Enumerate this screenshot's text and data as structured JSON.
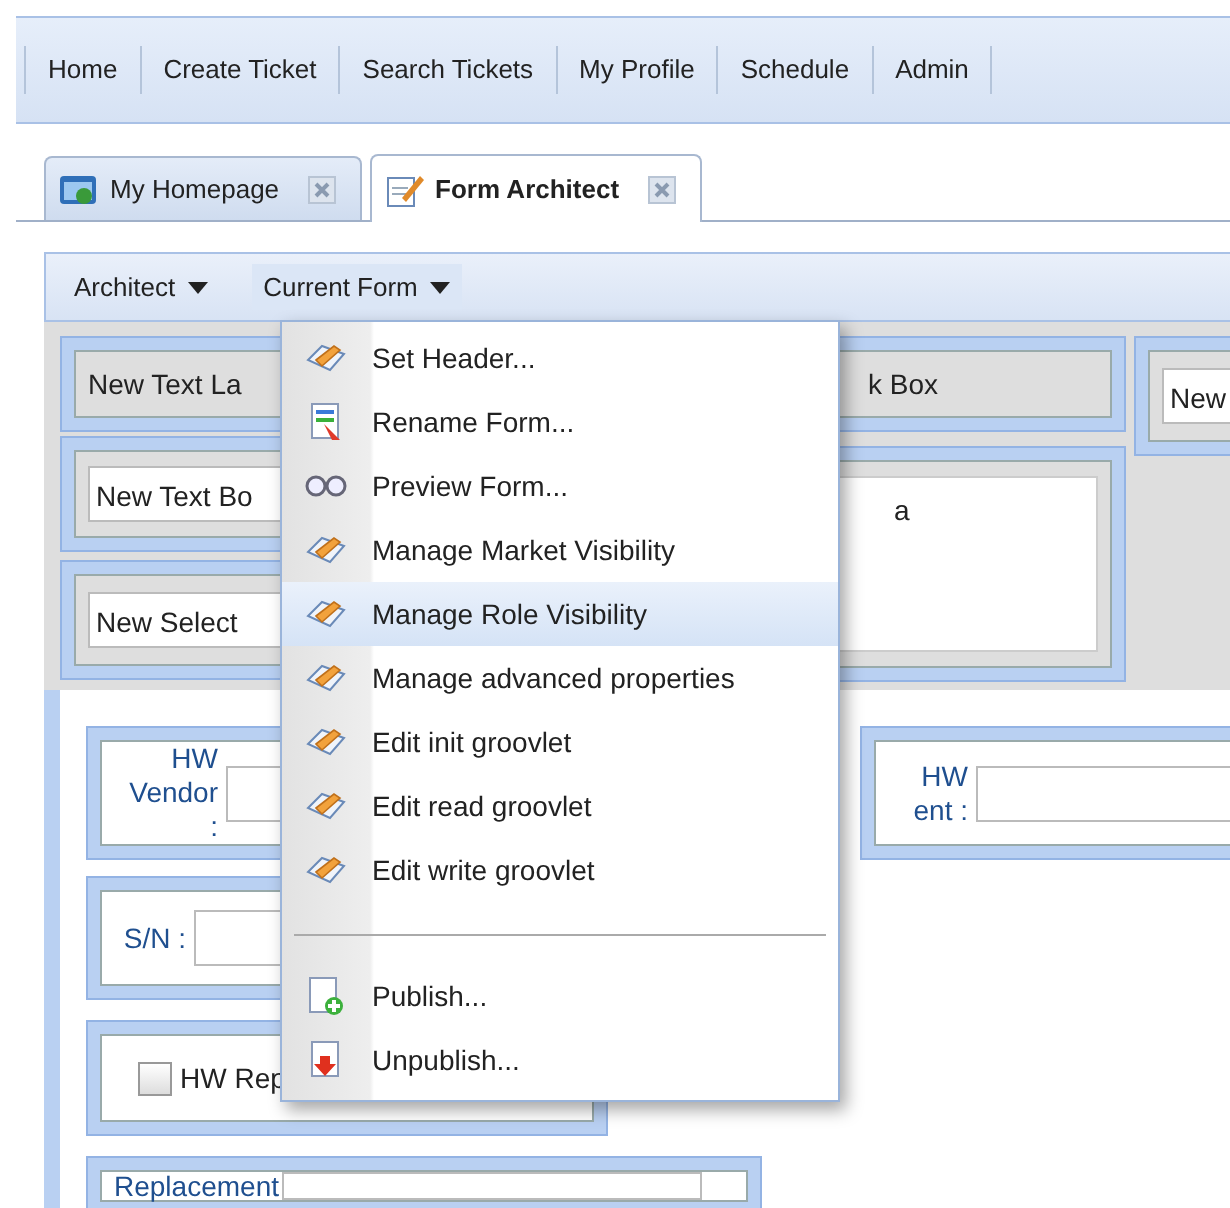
{
  "nav": {
    "items": [
      "Home",
      "Create Ticket",
      "Search Tickets",
      "My Profile",
      "Schedule",
      "Admin"
    ]
  },
  "tabs": [
    {
      "label": "My Homepage",
      "kind": "home",
      "selected": false
    },
    {
      "label": "Form Architect",
      "kind": "form",
      "selected": true
    }
  ],
  "toolbar": {
    "menus": [
      {
        "label": "Architect",
        "expanded": false
      },
      {
        "label": "Current Form",
        "expanded": true
      }
    ]
  },
  "canvas": {
    "widgets": [
      {
        "kind": "label",
        "text": "New Text La"
      },
      {
        "kind": "label",
        "text": "k Box"
      },
      {
        "kind": "input",
        "text": "New"
      },
      {
        "kind": "input",
        "text": "New Text Bo"
      },
      {
        "kind": "textarea",
        "text": "a"
      },
      {
        "kind": "input",
        "text": "New Select"
      }
    ]
  },
  "form": {
    "fields": [
      {
        "kind": "field",
        "label": "HW Vendor :"
      },
      {
        "kind": "field",
        "label": "HW ent :"
      },
      {
        "kind": "field",
        "label": "S/N :"
      },
      {
        "kind": "checkbox",
        "label": "HW Rep",
        "checked": false
      },
      {
        "kind": "field",
        "label": "Replacement"
      }
    ]
  },
  "menu": {
    "items": [
      {
        "kind": "edit",
        "label": "Set Header...",
        "selected": false
      },
      {
        "kind": "rename",
        "label": "Rename Form...",
        "selected": false
      },
      {
        "kind": "preview",
        "label": "Preview Form...",
        "selected": false
      },
      {
        "kind": "edit",
        "label": "Manage Market Visibility",
        "selected": false
      },
      {
        "kind": "edit",
        "label": "Manage Role Visibility",
        "selected": true
      },
      {
        "kind": "edit",
        "label": "Manage advanced properties",
        "selected": false
      },
      {
        "kind": "edit",
        "label": "Edit init groovlet",
        "selected": false
      },
      {
        "kind": "edit",
        "label": "Edit read groovlet",
        "selected": false
      },
      {
        "kind": "edit",
        "label": "Edit write groovlet",
        "selected": false
      },
      {
        "kind": "separator"
      },
      {
        "kind": "publish",
        "label": "Publish...",
        "selected": false
      },
      {
        "kind": "unpublish",
        "label": "Unpublish...",
        "selected": false
      }
    ]
  }
}
